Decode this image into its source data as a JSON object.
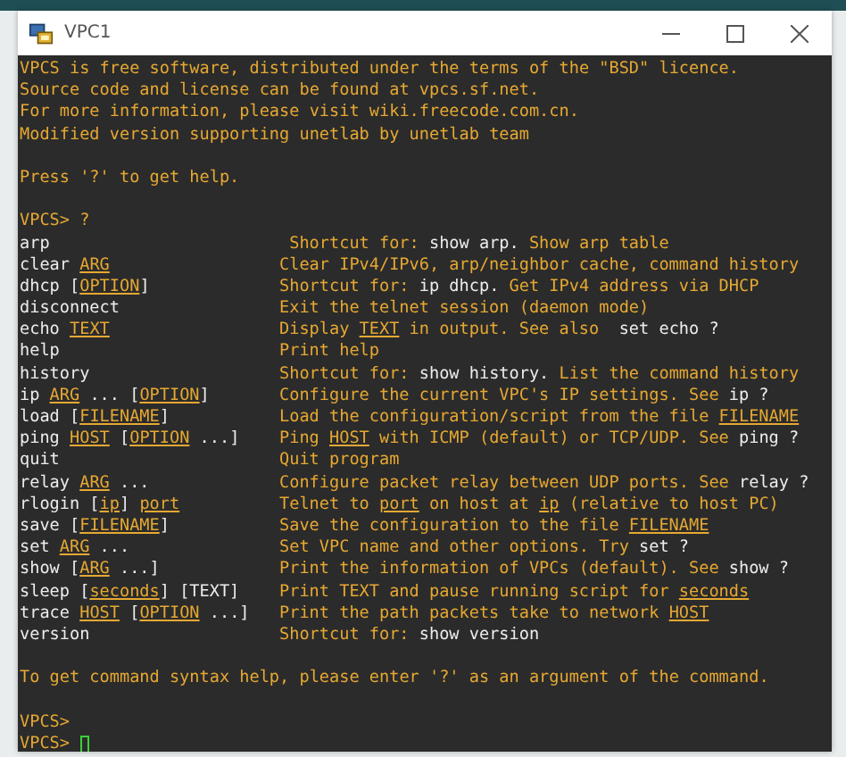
{
  "window": {
    "title": "VPC1"
  },
  "terminal": {
    "lines": [
      {
        "kind": "text",
        "segments": [
          {
            "text": "VPCS is free software, distributed under the terms of the \"BSD\" licence.",
            "kind": "accent"
          }
        ]
      },
      {
        "kind": "text",
        "segments": [
          {
            "text": "Source code and license can be found at vpcs.sf.net.",
            "kind": "accent"
          }
        ]
      },
      {
        "kind": "text",
        "segments": [
          {
            "text": "For more information, please visit wiki.freecode.com.cn.",
            "kind": "accent"
          }
        ]
      },
      {
        "kind": "text",
        "segments": [
          {
            "text": "Modified version supporting unetlab by unetlab team",
            "kind": "accent"
          }
        ]
      },
      {
        "kind": "blank"
      },
      {
        "kind": "text",
        "segments": [
          {
            "text": "Press '?' to get help.",
            "kind": "accent"
          }
        ]
      },
      {
        "kind": "blank"
      },
      {
        "kind": "text",
        "segments": [
          {
            "text": "VPCS> ?",
            "kind": "accent"
          }
        ]
      },
      {
        "kind": "command",
        "command": [
          {
            "text": "arp",
            "kind": "plain"
          }
        ],
        "description": [
          {
            "text": " Shortcut for: ",
            "kind": "accent"
          },
          {
            "text": "show arp.",
            "kind": "plain"
          },
          {
            "text": " Show arp table",
            "kind": "accent"
          }
        ]
      },
      {
        "kind": "command",
        "command": [
          {
            "text": "clear ",
            "kind": "plain"
          },
          {
            "text": "ARG",
            "kind": "underlined"
          }
        ],
        "description": [
          {
            "text": "Clear IPv4/IPv6, arp/neighbor cache, command history",
            "kind": "accent"
          }
        ]
      },
      {
        "kind": "command",
        "command": [
          {
            "text": "dhcp [",
            "kind": "plain"
          },
          {
            "text": "OPTION",
            "kind": "underlined"
          },
          {
            "text": "]",
            "kind": "plain"
          }
        ],
        "description": [
          {
            "text": "Shortcut for: ",
            "kind": "accent"
          },
          {
            "text": "ip dhcp.",
            "kind": "plain"
          },
          {
            "text": " Get IPv4 address via DHCP",
            "kind": "accent"
          }
        ]
      },
      {
        "kind": "command",
        "command": [
          {
            "text": "disconnect",
            "kind": "plain"
          }
        ],
        "description": [
          {
            "text": "Exit the telnet session (daemon mode)",
            "kind": "accent"
          }
        ]
      },
      {
        "kind": "command",
        "command": [
          {
            "text": "echo ",
            "kind": "plain"
          },
          {
            "text": "TEXT",
            "kind": "underlined"
          }
        ],
        "description": [
          {
            "text": "Display ",
            "kind": "accent"
          },
          {
            "text": "TEXT",
            "kind": "underlined"
          },
          {
            "text": " in output. See also  ",
            "kind": "accent"
          },
          {
            "text": "set echo ?",
            "kind": "plain"
          }
        ]
      },
      {
        "kind": "command",
        "command": [
          {
            "text": "help",
            "kind": "plain"
          }
        ],
        "description": [
          {
            "text": "Print help",
            "kind": "accent"
          }
        ]
      },
      {
        "kind": "command",
        "command": [
          {
            "text": "history",
            "kind": "plain"
          }
        ],
        "description": [
          {
            "text": "Shortcut for: ",
            "kind": "accent"
          },
          {
            "text": "show history.",
            "kind": "plain"
          },
          {
            "text": " List the command history",
            "kind": "accent"
          }
        ]
      },
      {
        "kind": "command",
        "command": [
          {
            "text": "ip ",
            "kind": "plain"
          },
          {
            "text": "ARG",
            "kind": "underlined"
          },
          {
            "text": " ... [",
            "kind": "plain"
          },
          {
            "text": "OPTION",
            "kind": "underlined"
          },
          {
            "text": "]",
            "kind": "plain"
          }
        ],
        "description": [
          {
            "text": "Configure the current VPC's IP settings. See ",
            "kind": "accent"
          },
          {
            "text": "ip ?",
            "kind": "plain"
          }
        ]
      },
      {
        "kind": "command",
        "command": [
          {
            "text": "load [",
            "kind": "plain"
          },
          {
            "text": "FILENAME",
            "kind": "underlined"
          },
          {
            "text": "]",
            "kind": "plain"
          }
        ],
        "description": [
          {
            "text": "Load the configuration/script from the file ",
            "kind": "accent"
          },
          {
            "text": "FILENAME",
            "kind": "underlined"
          }
        ]
      },
      {
        "kind": "command",
        "command": [
          {
            "text": "ping ",
            "kind": "plain"
          },
          {
            "text": "HOST",
            "kind": "underlined"
          },
          {
            "text": " [",
            "kind": "plain"
          },
          {
            "text": "OPTION",
            "kind": "underlined"
          },
          {
            "text": " ...]",
            "kind": "plain"
          }
        ],
        "description": [
          {
            "text": "Ping ",
            "kind": "accent"
          },
          {
            "text": "HOST",
            "kind": "underlined"
          },
          {
            "text": " with ICMP (default) or TCP/UDP. See ",
            "kind": "accent"
          },
          {
            "text": "ping ?",
            "kind": "plain"
          }
        ]
      },
      {
        "kind": "command",
        "command": [
          {
            "text": "quit",
            "kind": "plain"
          }
        ],
        "description": [
          {
            "text": "Quit program",
            "kind": "accent"
          }
        ]
      },
      {
        "kind": "command",
        "command": [
          {
            "text": "relay ",
            "kind": "plain"
          },
          {
            "text": "ARG",
            "kind": "underlined"
          },
          {
            "text": " ...",
            "kind": "plain"
          }
        ],
        "description": [
          {
            "text": "Configure packet relay between UDP ports. See ",
            "kind": "accent"
          },
          {
            "text": "relay ?",
            "kind": "plain"
          }
        ]
      },
      {
        "kind": "command",
        "command": [
          {
            "text": "rlogin [",
            "kind": "plain"
          },
          {
            "text": "ip",
            "kind": "underlined"
          },
          {
            "text": "] ",
            "kind": "plain"
          },
          {
            "text": "port",
            "kind": "underlined"
          }
        ],
        "description": [
          {
            "text": "Telnet to ",
            "kind": "accent"
          },
          {
            "text": "port",
            "kind": "underlined"
          },
          {
            "text": " on host at ",
            "kind": "accent"
          },
          {
            "text": "ip",
            "kind": "underlined"
          },
          {
            "text": " (relative to host PC)",
            "kind": "accent"
          }
        ]
      },
      {
        "kind": "command",
        "command": [
          {
            "text": "save [",
            "kind": "plain"
          },
          {
            "text": "FILENAME",
            "kind": "underlined"
          },
          {
            "text": "]",
            "kind": "plain"
          }
        ],
        "description": [
          {
            "text": "Save the configuration to the file ",
            "kind": "accent"
          },
          {
            "text": "FILENAME",
            "kind": "underlined"
          }
        ]
      },
      {
        "kind": "command",
        "command": [
          {
            "text": "set ",
            "kind": "plain"
          },
          {
            "text": "ARG",
            "kind": "underlined"
          },
          {
            "text": " ...",
            "kind": "plain"
          }
        ],
        "description": [
          {
            "text": "Set VPC name and other options. Try ",
            "kind": "accent"
          },
          {
            "text": "set ?",
            "kind": "plain"
          }
        ]
      },
      {
        "kind": "command",
        "command": [
          {
            "text": "show [",
            "kind": "plain"
          },
          {
            "text": "ARG",
            "kind": "underlined"
          },
          {
            "text": " ...]",
            "kind": "plain"
          }
        ],
        "description": [
          {
            "text": "Print the information of VPCs (default). See ",
            "kind": "accent"
          },
          {
            "text": "show ?",
            "kind": "plain"
          }
        ]
      },
      {
        "kind": "command",
        "command": [
          {
            "text": "sleep [",
            "kind": "plain"
          },
          {
            "text": "seconds",
            "kind": "underlined"
          },
          {
            "text": "] [TEXT]",
            "kind": "plain"
          }
        ],
        "description": [
          {
            "text": "Print TEXT and pause running script for ",
            "kind": "accent"
          },
          {
            "text": "seconds",
            "kind": "underlined"
          }
        ]
      },
      {
        "kind": "command",
        "command": [
          {
            "text": "trace ",
            "kind": "plain"
          },
          {
            "text": "HOST",
            "kind": "underlined"
          },
          {
            "text": " [",
            "kind": "plain"
          },
          {
            "text": "OPTION",
            "kind": "underlined"
          },
          {
            "text": " ...]",
            "kind": "plain"
          }
        ],
        "description": [
          {
            "text": "Print the path packets take to network ",
            "kind": "accent"
          },
          {
            "text": "HOST",
            "kind": "underlined"
          }
        ]
      },
      {
        "kind": "command",
        "command": [
          {
            "text": "version",
            "kind": "plain"
          }
        ],
        "description": [
          {
            "text": "Shortcut for: ",
            "kind": "accent"
          },
          {
            "text": "show version",
            "kind": "plain"
          }
        ]
      },
      {
        "kind": "blank"
      },
      {
        "kind": "text",
        "segments": [
          {
            "text": "To get command syntax help, please enter '?' as an argument of the command.",
            "kind": "accent"
          }
        ]
      },
      {
        "kind": "blank"
      },
      {
        "kind": "text",
        "segments": [
          {
            "text": "VPCS>",
            "kind": "accent"
          }
        ]
      },
      {
        "kind": "prompt",
        "segments": [
          {
            "text": "VPCS> ",
            "kind": "accent"
          }
        ],
        "cursor": true
      }
    ]
  }
}
